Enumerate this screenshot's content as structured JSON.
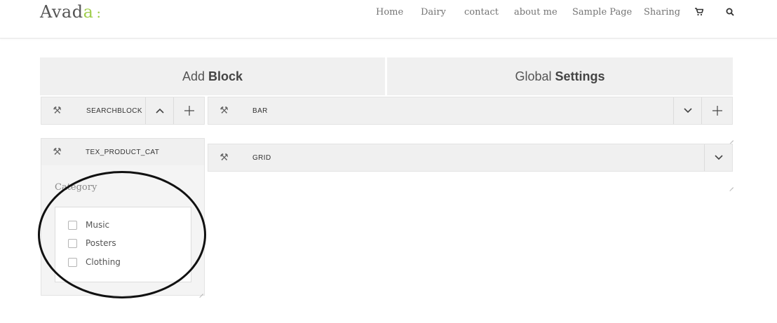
{
  "header": {
    "logo_main": "Avad",
    "logo_accent": "a",
    "logo_colon": ":",
    "nav": [
      "Home",
      "Dairy",
      "contact",
      "about me",
      "Sample Page",
      "Sharing"
    ],
    "icons": [
      "cart-icon",
      "search-icon"
    ]
  },
  "tabs": {
    "add_block_light": "Add",
    "add_block_bold": "Block",
    "global_light": "Global",
    "global_bold": "Settings"
  },
  "blocks": {
    "searchblock": "SEARCHBLOCK",
    "bar": "BAR",
    "tex_product_cat": "TEX_PRODUCT_CAT",
    "grid": "GRID"
  },
  "glyphs": {
    "tools": "⚒",
    "chevron_up": "⌃",
    "chevron_down": "⌄",
    "plus": "+",
    "cart": "🛒",
    "search": "⌕"
  },
  "category": {
    "title": "Category",
    "options": [
      "Music",
      "Posters",
      "Clothing"
    ]
  },
  "colors": {
    "accent": "#a0ce4e",
    "panel_bg": "#f0f0f0"
  }
}
